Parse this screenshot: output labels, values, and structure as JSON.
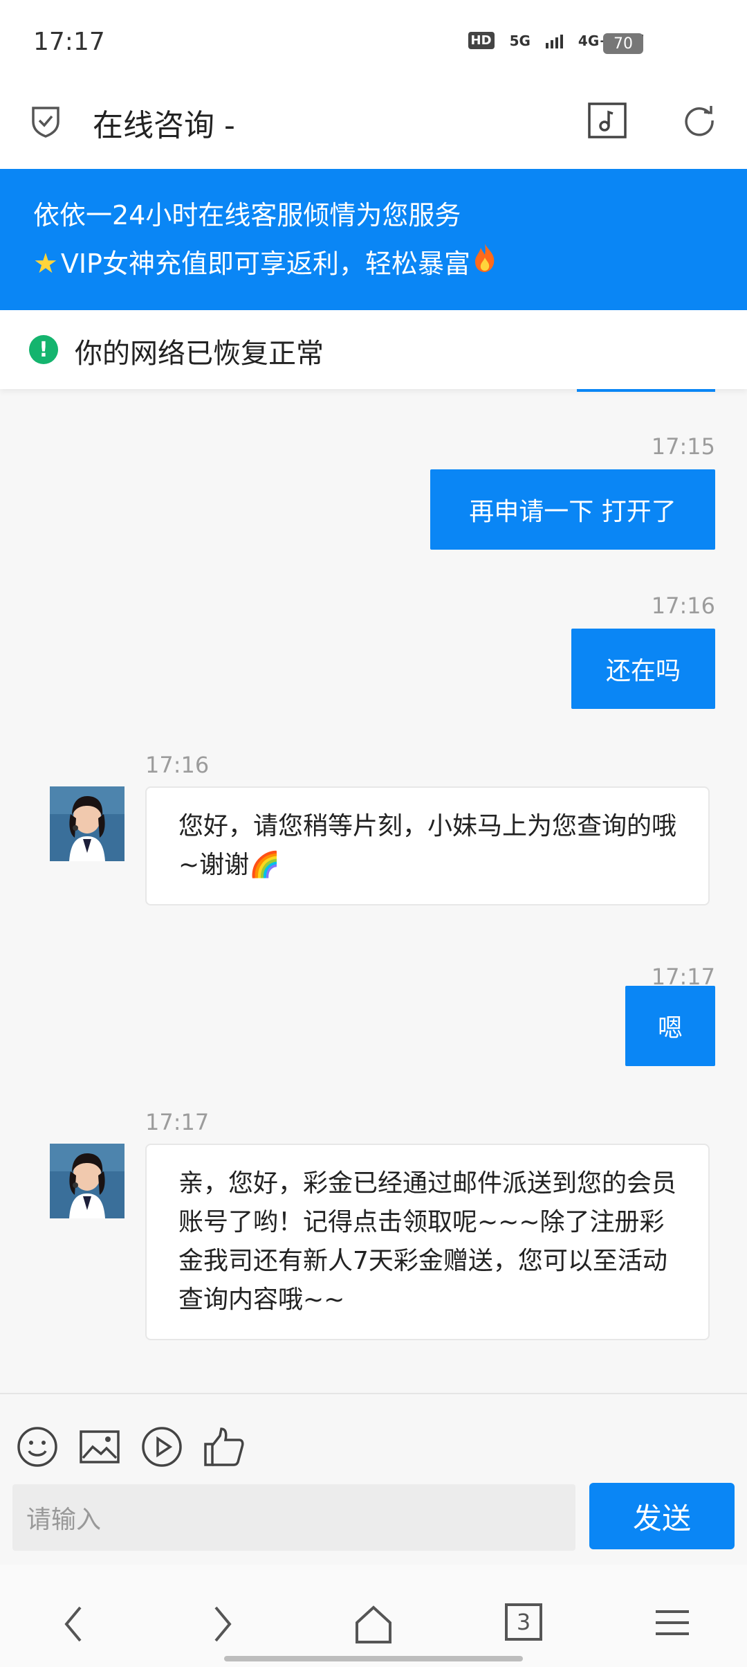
{
  "status_bar": {
    "time": "17:17",
    "signal_labels": [
      "HD",
      "5G",
      "4G+"
    ],
    "battery": "70"
  },
  "header": {
    "title": "在线咨询 -"
  },
  "banner": {
    "line1": "依依一24小时在线客服倾情为您服务",
    "line2": "VIP女神充值即可享返利，轻松暴富"
  },
  "notice": {
    "text": "你的网络已恢复正常"
  },
  "messages": [
    {
      "time": "17:15",
      "from": "user",
      "text": "再申请一下 打开了"
    },
    {
      "time": "17:16",
      "from": "user",
      "text": "还在吗"
    },
    {
      "time": "17:16",
      "from": "agent",
      "text": "您好，请您稍等片刻，小妹马上为您查询的哦~谢谢🌈"
    },
    {
      "time": "17:17",
      "from": "user",
      "text": "嗯"
    },
    {
      "time": "17:17",
      "from": "agent",
      "text": "亲，您好，彩金已经通过邮件派送到您的会员账号了哟！记得点击领取呢~~~除了注册彩金我司还有新人7天彩金赠送，您可以至活动查询内容哦~~"
    }
  ],
  "input": {
    "placeholder": "请输入",
    "send_label": "发送"
  },
  "nav": {
    "tabs_count": "3"
  },
  "colors": {
    "accent": "#0a86f5",
    "success": "#14b46e"
  }
}
